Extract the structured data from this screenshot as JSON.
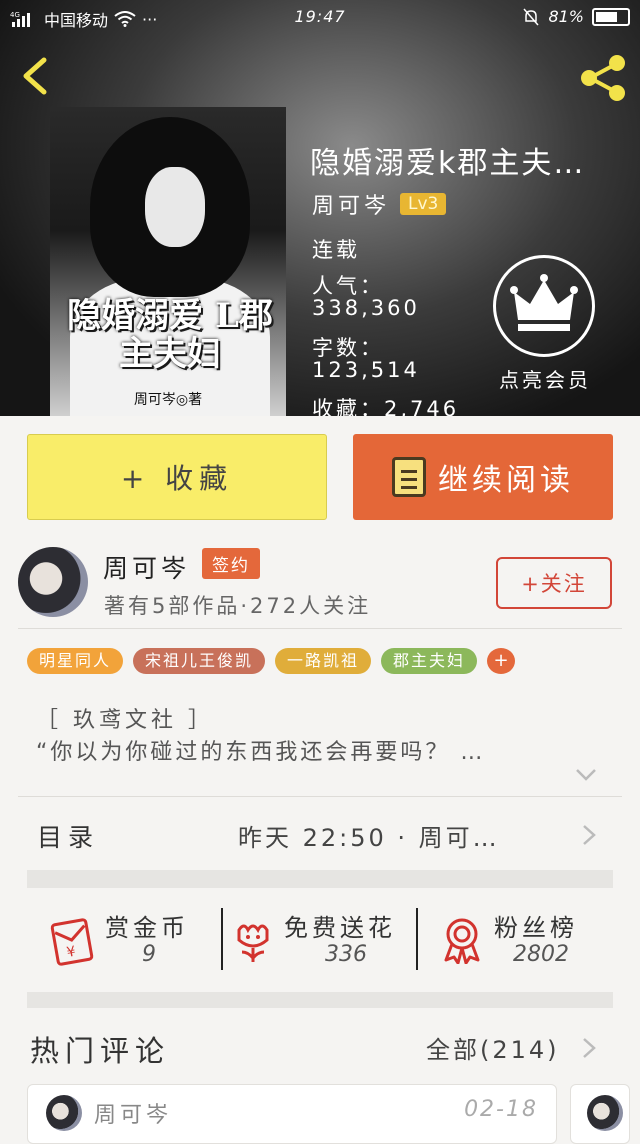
{
  "status_bar": {
    "network": "4G",
    "carrier": "中国移动",
    "more": "···",
    "time": "19:47",
    "battery": "81%",
    "battery_level": 0.81
  },
  "book": {
    "cover_title": "隐婚溺爱 L郡主夫妇",
    "cover_author": "周可岑◎著",
    "title": "隐婚溺爱k郡主夫…",
    "author": "周可岑",
    "level": "Lv3",
    "status": "连载",
    "popularity_label": "人气：",
    "popularity": "338,360",
    "wordcount_label": "字数：",
    "wordcount": "123,514",
    "favorites_label": "收藏：",
    "favorites": "2,746",
    "vip_label": "点亮会员"
  },
  "actions": {
    "collect": "+ 收藏",
    "continue_reading": "继续阅读"
  },
  "author": {
    "name": "周可岑",
    "badge": "签约",
    "summary": "著有5部作品·272人关注",
    "follow": "+关注"
  },
  "tags": [
    {
      "label": "明星同人",
      "color": "#f2a33a"
    },
    {
      "label": "宋祖儿王俊凯",
      "color": "#c8715a"
    },
    {
      "label": "一路凯祖",
      "color": "#e0ad3a"
    },
    {
      "label": "郡主夫妇",
      "color": "#8cb85b"
    }
  ],
  "tag_add": "+",
  "intro": {
    "line1": "［ 玖鸢文社 ］",
    "line2": "“你以为你碰过的东西我还会再要吗？ …"
  },
  "toc": {
    "label": "目录",
    "latest": "昨天  22:50 · 周可…"
  },
  "stats": [
    {
      "title": "赏金币",
      "value": "9",
      "icon": "red-envelope-icon"
    },
    {
      "title": "免费送花",
      "value": "336",
      "icon": "flower-icon"
    },
    {
      "title": "粉丝榜",
      "value": "2802",
      "icon": "medal-icon"
    }
  ],
  "comments": {
    "heading": "热门评论",
    "all": "全部(214)",
    "first": {
      "user": "周可岑",
      "date": "02-18"
    }
  },
  "colors": {
    "accent_orange": "#e46738",
    "collect_yellow": "#f9ed69",
    "follow_red": "#d24638"
  }
}
